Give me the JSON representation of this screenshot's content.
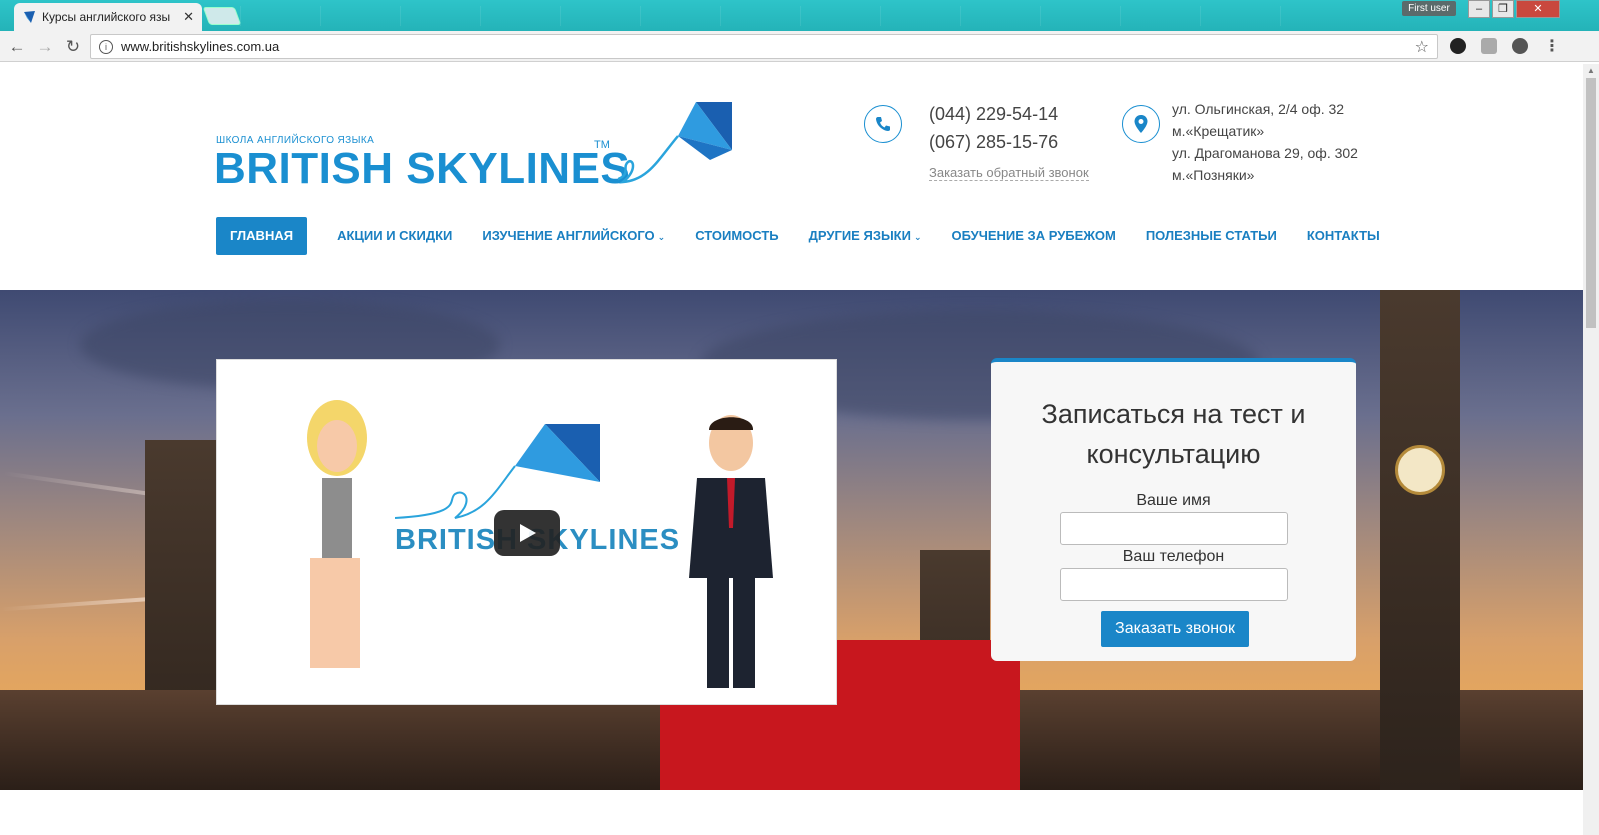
{
  "browser": {
    "tab_title": "Курсы английского язы",
    "address": "www.britishskylines.com.ua",
    "user_badge": "First user"
  },
  "logo": {
    "subtitle": "ШКОЛА АНГЛИЙСКОГО ЯЗЫКА",
    "name": "BRITISH SKYLINES",
    "tm": "TM"
  },
  "contacts": {
    "phone1": "(044) 229-54-14",
    "phone2": "(067) 285-15-76",
    "callback": "Заказать обратный звонок",
    "addr1": "ул. Ольгинская, 2/4 оф. 32",
    "addr1_metro": "м.«Крещатик»",
    "addr2": "ул. Драгоманова 29, оф. 302",
    "addr2_metro": "м.«Позняки»"
  },
  "nav": {
    "items": [
      {
        "label": "ГЛАВНАЯ"
      },
      {
        "label": "АКЦИИ И СКИДКИ"
      },
      {
        "label": "ИЗУЧЕНИЕ АНГЛИЙСКОГО"
      },
      {
        "label": "СТОИМОСТЬ"
      },
      {
        "label": "ДРУГИЕ ЯЗЫКИ"
      },
      {
        "label": "ОБУЧЕНИЕ ЗА РУБЕЖОМ"
      },
      {
        "label": "ПОЛЕЗНЫЕ СТАТЬИ"
      },
      {
        "label": "КОНТАКТЫ"
      }
    ]
  },
  "video": {
    "logo_text": "BRITISH SKYLINES"
  },
  "form": {
    "title_line1": "Записаться на тест и",
    "title_line2": "консультацию",
    "name_label": "Ваше имя",
    "name_value": "",
    "phone_label": "Ваш телефон",
    "phone_value": "",
    "submit": "Заказать звонок"
  },
  "colors": {
    "brand": "#1a86c8",
    "tabstrip": "#2ec4c9"
  }
}
